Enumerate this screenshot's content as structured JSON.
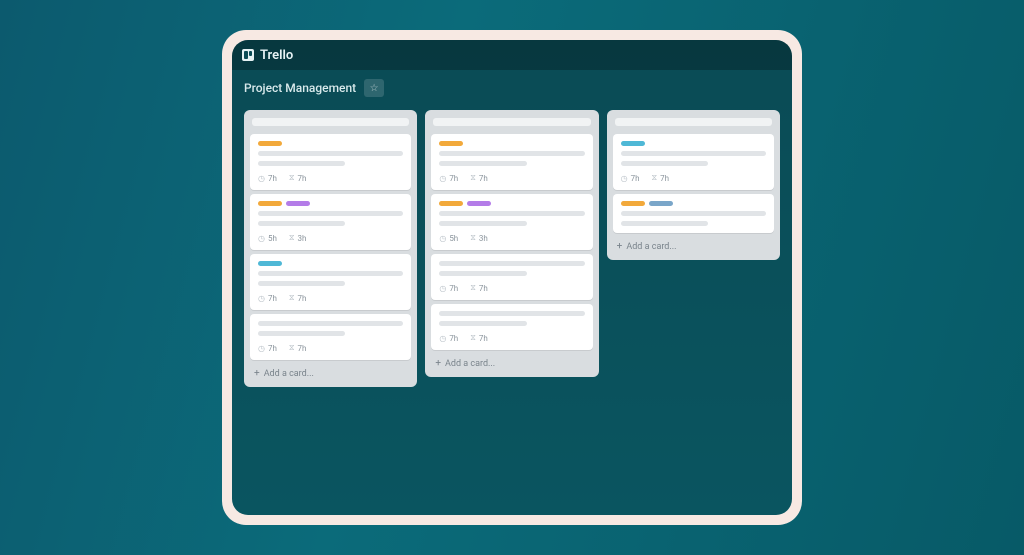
{
  "app": {
    "name": "Trello"
  },
  "board": {
    "title": "Project Management"
  },
  "addCardLabel": "Add a card...",
  "lists": [
    {
      "cards": [
        {
          "labels": [
            "orange"
          ],
          "meta": [
            {
              "icon": "clock",
              "text": "7h"
            },
            {
              "icon": "hourglass",
              "text": "7h"
            }
          ]
        },
        {
          "labels": [
            "orange",
            "purple"
          ],
          "meta": [
            {
              "icon": "clock",
              "text": "5h"
            },
            {
              "icon": "hourglass",
              "text": "3h"
            }
          ]
        },
        {
          "labels": [
            "blue"
          ],
          "meta": [
            {
              "icon": "clock",
              "text": "7h"
            },
            {
              "icon": "hourglass",
              "text": "7h"
            }
          ]
        },
        {
          "labels": [],
          "meta": [
            {
              "icon": "clock",
              "text": "7h"
            },
            {
              "icon": "hourglass",
              "text": "7h"
            }
          ]
        }
      ]
    },
    {
      "cards": [
        {
          "labels": [
            "orange"
          ],
          "meta": [
            {
              "icon": "clock",
              "text": "7h"
            },
            {
              "icon": "hourglass",
              "text": "7h"
            }
          ]
        },
        {
          "labels": [
            "orange",
            "purple"
          ],
          "meta": [
            {
              "icon": "clock",
              "text": "5h"
            },
            {
              "icon": "hourglass",
              "text": "3h"
            }
          ]
        },
        {
          "labels": [],
          "meta": [
            {
              "icon": "clock",
              "text": "7h"
            },
            {
              "icon": "hourglass",
              "text": "7h"
            }
          ]
        },
        {
          "labels": [],
          "meta": [
            {
              "icon": "clock",
              "text": "7h"
            },
            {
              "icon": "hourglass",
              "text": "7h"
            }
          ]
        }
      ]
    },
    {
      "cards": [
        {
          "labels": [
            "blue"
          ],
          "meta": [
            {
              "icon": "clock",
              "text": "7h"
            },
            {
              "icon": "hourglass",
              "text": "7h"
            }
          ]
        },
        {
          "labels": [
            "orange",
            "bluegray"
          ],
          "meta": []
        }
      ]
    }
  ]
}
